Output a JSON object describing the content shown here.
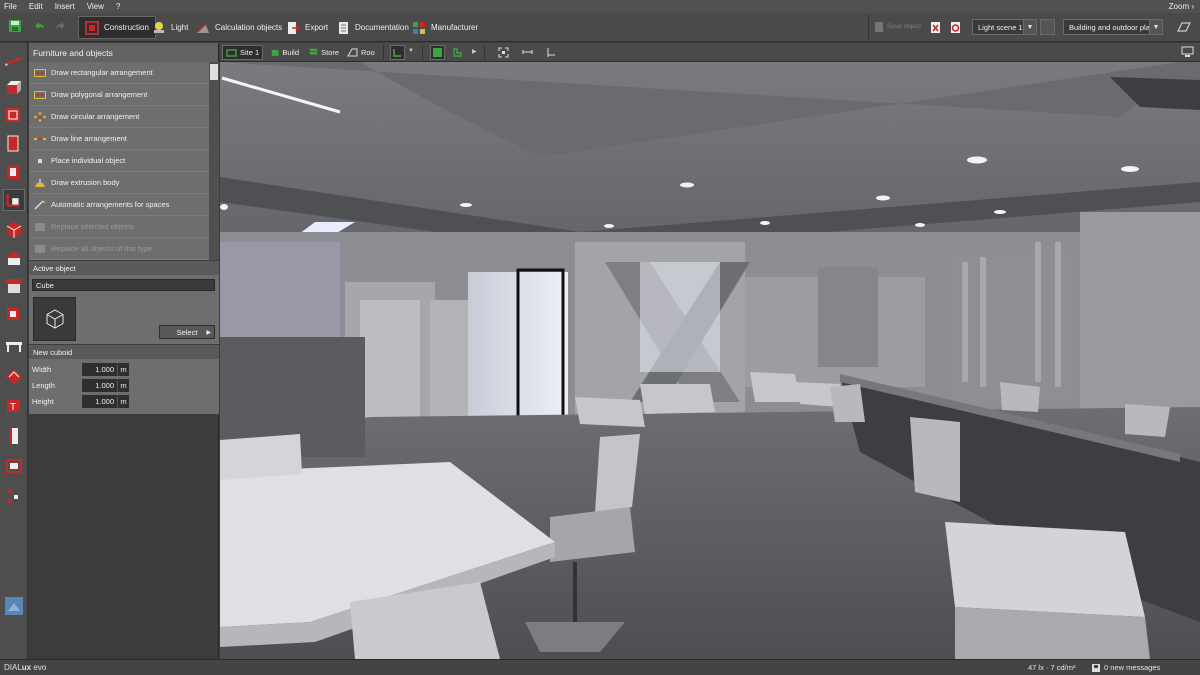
{
  "menubar": {
    "items": [
      "File",
      "Edit",
      "Insert",
      "View",
      "?"
    ],
    "zoom": "Zoom ›"
  },
  "toolbar": {
    "tabs": [
      {
        "label": "Construction",
        "icon": "construction-icon",
        "active": true
      },
      {
        "label": "Light",
        "icon": "light-icon",
        "active": false
      },
      {
        "label": "Calculation objects",
        "icon": "calculation-objects-icon",
        "active": false
      },
      {
        "label": "Export",
        "icon": "export-icon",
        "active": false
      },
      {
        "label": "Documentation",
        "icon": "documentation-icon",
        "active": false
      },
      {
        "label": "Manufacturer",
        "icon": "manufacturer-icon",
        "active": false
      }
    ],
    "faded_button": "Save object",
    "light_scene": "Light scene 1",
    "plan_select": "Building and outdoor pla..."
  },
  "panel": {
    "title": "Furniture and objects",
    "items": [
      {
        "label": "Draw rectangular arrangement",
        "icon": "rectangular-arrangement-icon",
        "enabled": true
      },
      {
        "label": "Draw polygonal arrangement",
        "icon": "polygonal-arrangement-icon",
        "enabled": true
      },
      {
        "label": "Draw circular arrangement",
        "icon": "circular-arrangement-icon",
        "enabled": true
      },
      {
        "label": "Draw line arrangement",
        "icon": "line-arrangement-icon",
        "enabled": true
      },
      {
        "label": "Place individual object",
        "icon": "individual-object-icon",
        "enabled": true
      },
      {
        "label": "Draw extrusion body",
        "icon": "extrusion-body-icon",
        "enabled": true
      },
      {
        "label": "Automatic arrangements for spaces",
        "icon": "auto-arrangement-icon",
        "enabled": true
      },
      {
        "label": "Replace selected objects",
        "icon": "replace-selected-icon",
        "enabled": false
      },
      {
        "label": "Replace all objects of this type",
        "icon": "replace-all-icon",
        "enabled": false
      }
    ],
    "active_object": {
      "title": "Active object",
      "name": "Cube",
      "select_label": "Select"
    },
    "new_cuboid": {
      "title": "New cuboid",
      "width": {
        "label": "Width",
        "value": "1.000",
        "unit": "m"
      },
      "length": {
        "label": "Length",
        "value": "1.000",
        "unit": "m"
      },
      "height": {
        "label": "Height",
        "value": "1.000",
        "unit": "m"
      }
    }
  },
  "viewbar": {
    "tabs": [
      {
        "label": "Site 1",
        "active": true
      },
      {
        "label": "Build",
        "active": false
      },
      {
        "label": "Store",
        "active": false
      },
      {
        "label": "Roo",
        "active": false
      }
    ]
  },
  "status": {
    "brand_a": "DIAL",
    "brand_b": "ux",
    "brand_c": "evo",
    "readout": "47 lx · 7 cd/m²",
    "messages": "0 new messages"
  },
  "colors": {
    "accent_red": "#c62828",
    "accent_green": "#3fa33f",
    "panel_bg": "#6e6e6e"
  }
}
